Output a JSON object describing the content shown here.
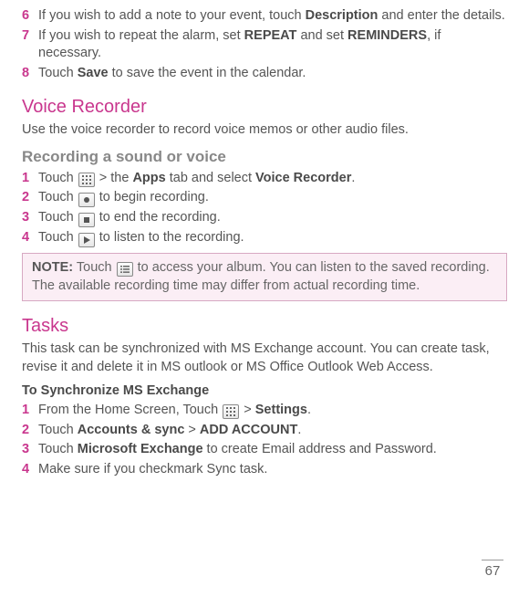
{
  "top_steps": [
    {
      "num": "6",
      "parts": [
        "If you wish to add a note to your event, touch ",
        {
          "b": "Description"
        },
        " and enter the details."
      ]
    },
    {
      "num": "7",
      "parts": [
        "If you wish to repeat the alarm, set ",
        {
          "b": "REPEAT"
        },
        " and set ",
        {
          "b": "REMINDERS"
        },
        ", if necessary."
      ]
    },
    {
      "num": "8",
      "parts": [
        "Touch ",
        {
          "b": "Save"
        },
        " to save the event in the calendar."
      ]
    }
  ],
  "voice_title": "Voice Recorder",
  "voice_intro": "Use the voice recorder to record voice memos or other audio files.",
  "voice_sub": "Recording a sound or voice",
  "voice_steps": [
    {
      "num": "1",
      "parts": [
        "Touch ",
        {
          "icon": "grid"
        },
        " > the ",
        {
          "b": "Apps"
        },
        " tab and select ",
        {
          "b": "Voice Recorder"
        },
        "."
      ]
    },
    {
      "num": "2",
      "parts": [
        "Touch ",
        {
          "icon": "record"
        },
        " to begin recording."
      ]
    },
    {
      "num": "3",
      "parts": [
        "Touch ",
        {
          "icon": "stop"
        },
        " to end the recording."
      ]
    },
    {
      "num": "4",
      "parts": [
        "Touch ",
        {
          "icon": "play"
        },
        " to listen to the recording."
      ]
    }
  ],
  "note_label": "NOTE:",
  "note_parts": [
    " Touch ",
    {
      "icon": "list"
    },
    " to access your album. You can listen to the saved recording. The available recording time may differ from actual recording time."
  ],
  "tasks_title": "Tasks",
  "tasks_intro": "This task can be synchronized with MS Exchange account. You can create task, revise it and delete it in MS outlook or MS Office Outlook Web Access.",
  "sync_title": "To Synchronize MS Exchange",
  "sync_steps": [
    {
      "num": "1",
      "parts": [
        "From the Home Screen, Touch ",
        {
          "icon": "grid"
        },
        " > ",
        {
          "b": "Settings"
        },
        "."
      ]
    },
    {
      "num": "2",
      "parts": [
        "Touch ",
        {
          "b": "Accounts & sync"
        },
        " > ",
        {
          "b": "ADD ACCOUNT"
        },
        "."
      ]
    },
    {
      "num": "3",
      "parts": [
        "Touch ",
        {
          "b": "Microsoft Exchange"
        },
        " to create Email address and Password."
      ]
    },
    {
      "num": "4",
      "parts": [
        "Make sure if you checkmark Sync task."
      ]
    }
  ],
  "page_number": "67"
}
